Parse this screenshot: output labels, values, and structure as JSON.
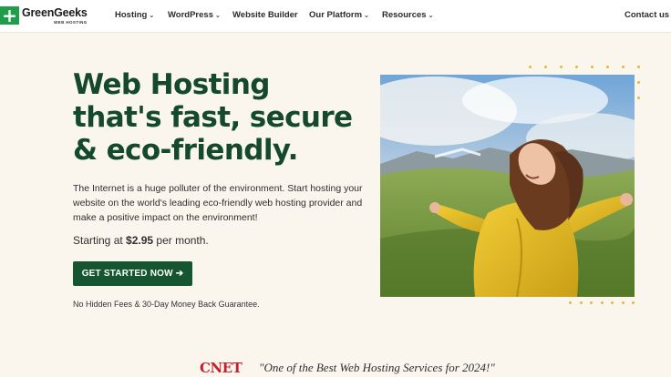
{
  "brand": {
    "name": "GreenGeeks",
    "sub": "WEB HOSTING",
    "mark": "+"
  },
  "nav": {
    "items": [
      {
        "label": "Hosting",
        "dropdown": true
      },
      {
        "label": "WordPress",
        "dropdown": true
      },
      {
        "label": "Website Builder",
        "dropdown": false
      },
      {
        "label": "Our Platform",
        "dropdown": true
      },
      {
        "label": "Resources",
        "dropdown": true
      }
    ],
    "contact": "Contact us",
    "chevron": "⌄"
  },
  "hero": {
    "title": "Web Hosting that's fast, secure & eco-friendly.",
    "description": "The Internet is a huge polluter of the environment. Start hosting your website on the world's leading eco-friendly web hosting provider and make a positive impact on the environment!",
    "price_prefix": "Starting at ",
    "price": "$2.95",
    "price_suffix": " per month.",
    "cta": "GET STARTED NOW ➔",
    "guarantee": "No Hidden Fees & 30-Day Money Back Guarantee."
  },
  "press": {
    "logo": "CNET",
    "quote": "\"One of the Best Web Hosting Services for 2024!\""
  },
  "colors": {
    "brand_green": "#1f9d4b",
    "cta_green": "#15552f",
    "title_green": "#14492e",
    "dot_yellow": "#e8b53d",
    "cnet_red": "#c5202a",
    "background": "#faf6ee"
  }
}
